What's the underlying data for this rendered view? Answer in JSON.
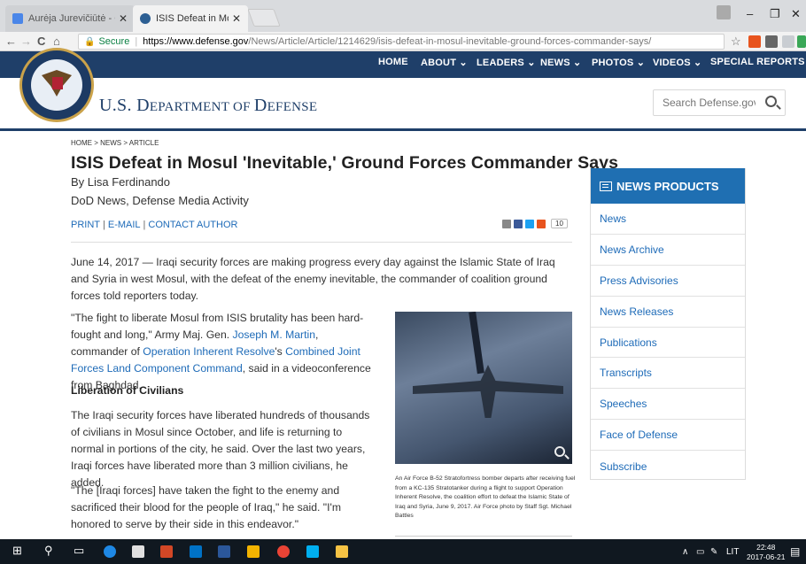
{
  "browser": {
    "tabs": [
      {
        "title": "Aurėja Jurevičiūtė - Goo",
        "close": "✕"
      },
      {
        "title": "ISIS Defeat in Mosul 'Ine",
        "close": "✕"
      }
    ],
    "window_controls": {
      "minimize": "–",
      "maximize": "❐",
      "close": "✕"
    },
    "nav": {
      "back": "←",
      "forward": "→",
      "reload": "C",
      "home": "⌂"
    },
    "secure_label": "Secure",
    "url_host": "https://www.defense.gov",
    "url_path": "/News/Article/Article/1214629/isis-defeat-in-mosul-inevitable-ground-forces-commander-says/",
    "bookmark": "☆"
  },
  "site": {
    "nav_items": [
      "HOME",
      "ABOUT ⌄",
      "LEADERS ⌄",
      "NEWS ⌄",
      "PHOTOS ⌄",
      "VIDEOS ⌄",
      "SPECIAL REPORTS"
    ],
    "department_big": "U.S. D",
    "department_small": "EPARTMENT OF ",
    "department_big2": "D",
    "department_small2": "EFENSE",
    "search_placeholder": "Search Defense.gov"
  },
  "article": {
    "breadcrumb": "HOME  >  NEWS  >  ARTICLE",
    "title": "ISIS Defeat in Mosul 'Inevitable,' Ground Forces Commander Says",
    "byline": "By Lisa Ferdinando",
    "org": "DoD News, Defense Media Activity",
    "actions": {
      "print": "PRINT",
      "email": "E-MAIL",
      "contact": "CONTACT AUTHOR"
    },
    "share_count": "10",
    "lead": "June 14, 2017 — Iraqi security forces are making progress every day against the Islamic State of Iraq and Syria in west Mosul, with the defeat of the enemy inevitable, the commander of coalition ground forces told reporters today.",
    "p2": {
      "t1": "\"The fight to liberate Mosul from ISIS brutality has been hard-fought and long,\" Army Maj. Gen. ",
      "l1": "Joseph M. Martin",
      "t2": ", commander of ",
      "l2": "Operation Inherent Resolve",
      "t3": "'s ",
      "l3": "Combined Joint Forces Land Component Command",
      "t4": ", said in a videoconference from Baghdad."
    },
    "subhead": "Liberation of Civilians",
    "p3": "The Iraqi security forces have liberated hundreds of thousands of civilians in Mosul since October, and life is returning to normal in portions of the city, he said. Over the last two years, Iraqi forces have liberated more than 3 million civilians, he added.",
    "p4": "\"The [Iraqi forces] have taken the fight to the enemy and sacrificed their blood for the people of Iraq,\" he said. \"I'm honored to serve by their side in this endeavor.\"",
    "caption": "An Air Force B-52 Stratofortress bomber departs after receiving fuel from a KC-135 Stratotanker during a flight to support Operation Inherent Resolve, the coalition effort to defeat the Islamic State of Iraq and Syria, June 9, 2017. Air Force photo by Staff Sgt. Michael Battles"
  },
  "sidebar": {
    "heading": "NEWS PRODUCTS",
    "items": [
      "News",
      "News Archive",
      "Press Advisories",
      "News Releases",
      "Publications",
      "Transcripts",
      "Speeches",
      "Face of Defense",
      "Subscribe"
    ]
  },
  "taskbar": {
    "lang": "LIT",
    "time": "22:48",
    "date": "2017-06-21"
  },
  "colors": {
    "nav_bg": "#1f3f69",
    "link": "#1e6bb8",
    "sidebar_header": "#1f6fb2"
  }
}
